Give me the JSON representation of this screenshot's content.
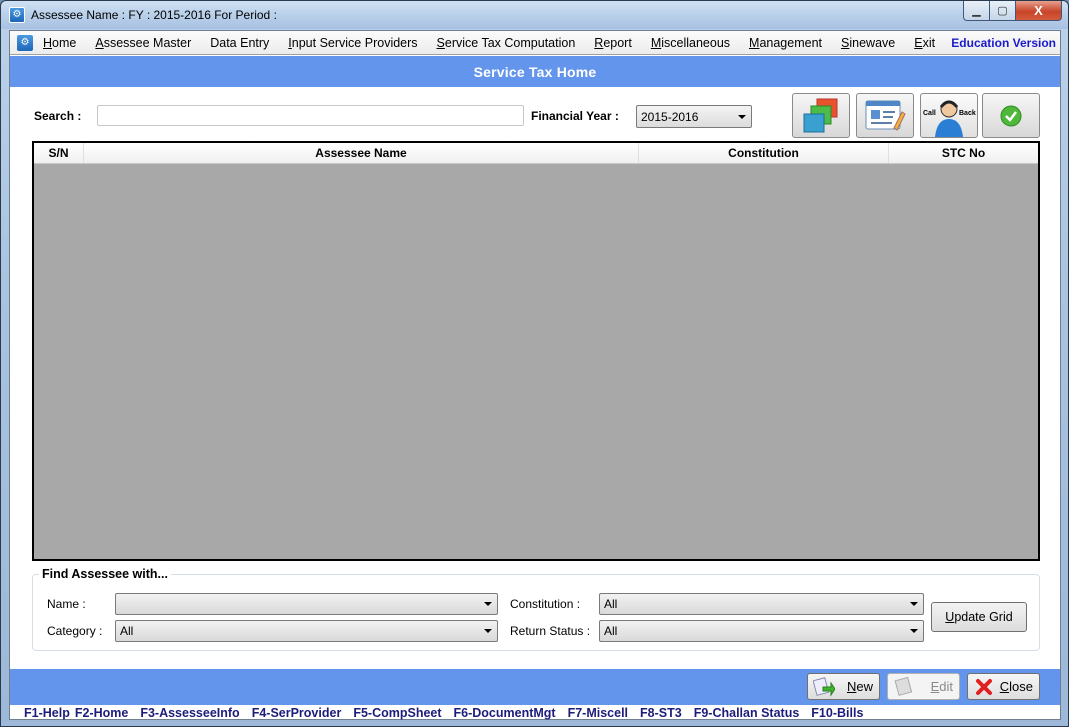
{
  "window": {
    "title": "Assessee Name :   FY : 2015-2016 For Period :",
    "controls": {
      "minimize": "▁",
      "maximize": "▢",
      "close": "X"
    },
    "app_icon": "gear-icon"
  },
  "menubar": {
    "items": [
      {
        "pre": "",
        "u": "H",
        "post": "ome"
      },
      {
        "pre": "",
        "u": "A",
        "post": "ssessee Master"
      },
      {
        "pre": "Data Entry",
        "u": "",
        "post": ""
      },
      {
        "pre": "",
        "u": "I",
        "post": "nput Service Providers"
      },
      {
        "pre": "",
        "u": "S",
        "post": "ervice Tax Computation"
      },
      {
        "pre": "",
        "u": "R",
        "post": "eport"
      },
      {
        "pre": "",
        "u": "M",
        "post": "iscellaneous"
      },
      {
        "pre": "",
        "u": "M",
        "post": "anagement"
      },
      {
        "pre": "",
        "u": "S",
        "post": "inewave"
      },
      {
        "pre": "",
        "u": "E",
        "post": "xit"
      }
    ],
    "edition": "Education Version"
  },
  "header": {
    "title": "Service Tax Home"
  },
  "search": {
    "label": "Search :",
    "value": "",
    "placeholder": ""
  },
  "financial_year": {
    "label": "Financial Year :",
    "selected": "2015-2016"
  },
  "toolbar": {
    "buttons": [
      {
        "name": "windows-icon"
      },
      {
        "name": "profile-edit-icon"
      },
      {
        "name": "call-back-icon",
        "left": "Call",
        "right": "Back"
      },
      {
        "name": "check-icon"
      }
    ]
  },
  "grid": {
    "columns": [
      "S/N",
      "Assessee Name",
      "Constitution",
      "STC No"
    ],
    "rows": []
  },
  "find": {
    "legend": "Find Assessee with...",
    "name_label": "Name :",
    "name_value": "",
    "category_label": "Category :",
    "category_value": "All",
    "constitution_label": "Constitution  :",
    "constitution_value": "All",
    "return_status_label": "Return Status :",
    "return_status_value": "All",
    "update_u": "U",
    "update_rest": "pdate Grid"
  },
  "footer": {
    "new": {
      "u": "N",
      "rest": "ew"
    },
    "edit": {
      "u": "E",
      "rest": "dit"
    },
    "close": {
      "u": "C",
      "rest": "lose"
    }
  },
  "fkeys": [
    "F1-Help",
    "F2-Home",
    "F3-AssesseeInfo",
    "F4-SerProvider",
    "F5-CompSheet",
    "F6-DocumentMgt",
    "F7-Miscell",
    "F8-ST3",
    "F9-Challan Status",
    "F10-Bills"
  ],
  "colors": {
    "accent_band": "#6495ed",
    "fkey_text": "#1c1c7a",
    "edition_text": "#1a1acc",
    "grid_bg": "#a8a8a8"
  }
}
